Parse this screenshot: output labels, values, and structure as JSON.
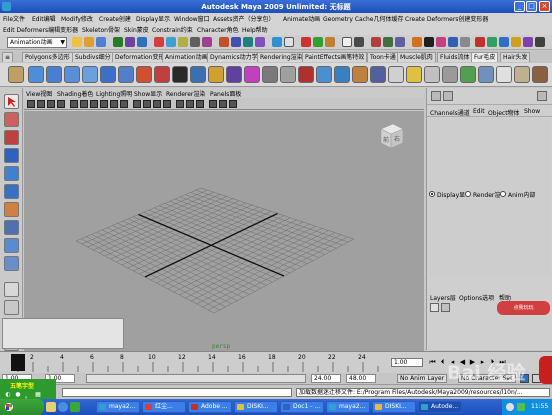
{
  "window": {
    "title": "Autodesk Maya 2009 Unlimited: 无标题"
  },
  "menus": {
    "row1": [
      "File文件",
      "Edit编辑",
      "Modify修改",
      "Create创建",
      "Display显示",
      "Window窗口",
      "Assets资产（分享包）",
      "Animate动画",
      "Geometry Cache几何体缓存",
      "Create Deformers创建变形器"
    ],
    "row2": [
      "Edit Deformers编辑变形器",
      "Skeleton骨架",
      "Skin蒙皮",
      "Constrain约束",
      "Character角色",
      "Help帮助"
    ]
  },
  "statusline": {
    "mode": "Animation动画"
  },
  "shelf_tabs": [
    "Polygons多边形",
    "Subdivs细分",
    "Deformation变形",
    "Animation动画",
    "Dynamics动力学",
    "Rendering渲染",
    "PaintEffects画笔特效",
    "Toon卡通",
    "Muscle肌肉",
    "Fluids流体",
    "Fur毛皮",
    "Hair头发"
  ],
  "panel_menus": [
    "View视图",
    "Shading着色",
    "Lighting照明",
    "Show显示",
    "Renderer渲染",
    "Panels面板"
  ],
  "viewport": {
    "camera": "persp",
    "viewcube_front": "前",
    "viewcube_right": "右"
  },
  "channel_box": {
    "tabs": [
      "Channels通道",
      "Edit",
      "Object物体",
      "Show"
    ],
    "layer_modes": [
      "Display显",
      "Render渲",
      "Anim内部"
    ],
    "layer_menus": [
      "Layers层",
      "Options选项",
      "帮助"
    ],
    "layer_badge": "点我玩玩"
  },
  "timeslider": {
    "ticks": [
      "2",
      "4",
      "6",
      "8",
      "10",
      "12",
      "14",
      "16",
      "18",
      "20",
      "22",
      "24"
    ],
    "current_frame": "1.00"
  },
  "range": {
    "start": "1.00",
    "inner_start": "1.00",
    "inner_end": "24.00",
    "end": "48.00",
    "anim_layer": "No Anim Layer",
    "character": "No Character Set"
  },
  "ime": {
    "label": "五笔字型"
  },
  "command": {
    "feedback": "加载数据迷迁移文件: E:/Program Files/Autodesk/Maya2009/resources/l10n/..."
  },
  "taskbar": {
    "items": [
      "maya2...",
      "红尘...",
      "Adobe ...",
      "DISKI...",
      "Doc1 - ...",
      "maya2...",
      "DISKI...",
      "Autode..."
    ],
    "clock": "11:55"
  },
  "watermark": "Bai 经验"
}
